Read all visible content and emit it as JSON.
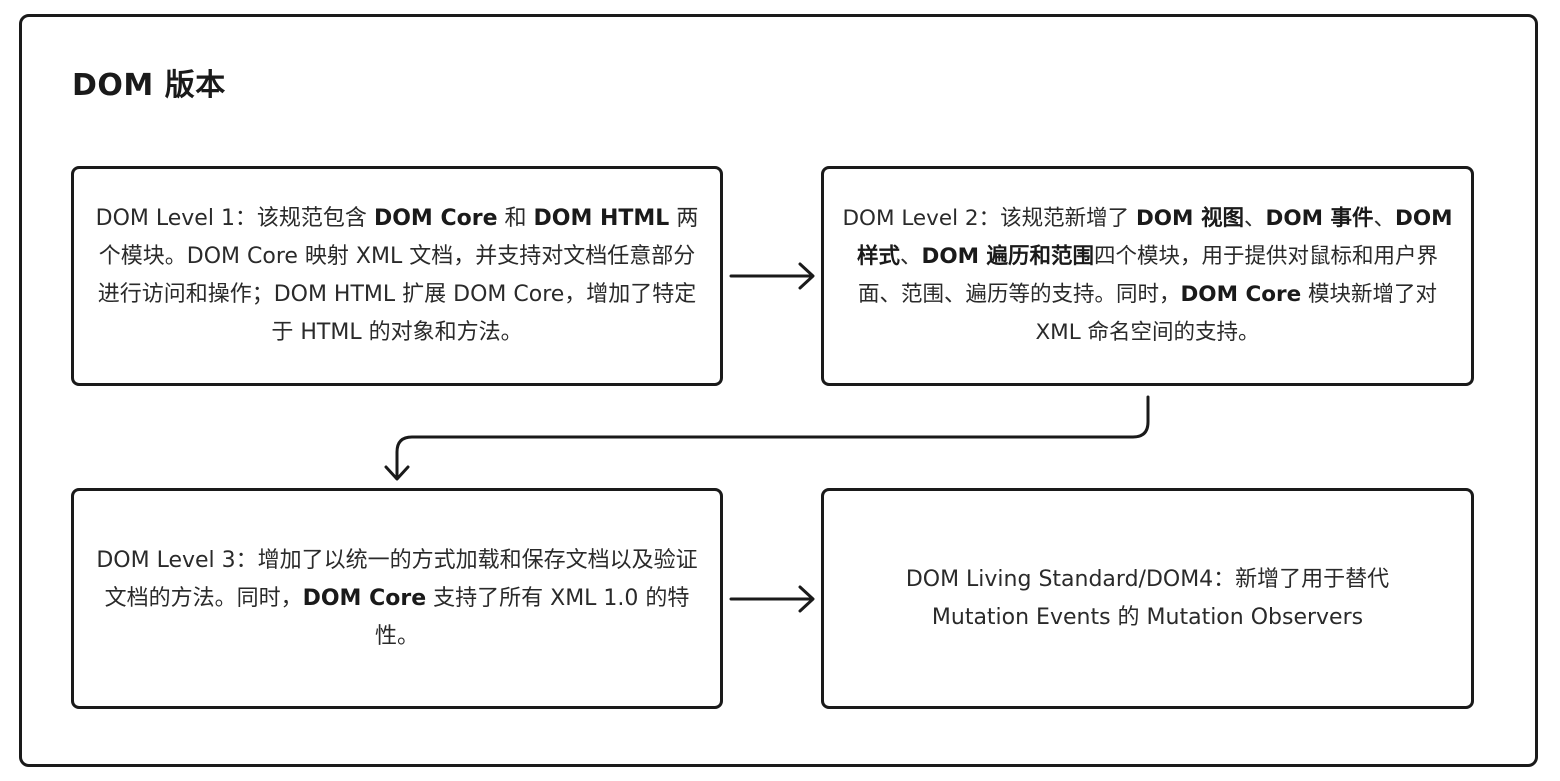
{
  "title": "DOM 版本",
  "boxes": {
    "level1": {
      "s1": "DOM Level 1：该规范包含 ",
      "b1": "DOM Core",
      "s2": " 和 ",
      "b2": "DOM HTML",
      "s3": " 两个模块。DOM Core 映射 XML 文档，并支持对文档任意部分进行访问和操作；DOM HTML 扩展 DOM Core，增加了特定于 HTML 的对象和方法。"
    },
    "level2": {
      "s1": "DOM Level 2：该规范新增了 ",
      "b1": "DOM 视图",
      "s2": "、",
      "b2": "DOM 事件",
      "s3": "、",
      "b3": "DOM 样式",
      "s4": "、",
      "b4": "DOM 遍历和范围",
      "s5": "四个模块，用于提供对鼠标和用户界面、范围、遍历等的支持。同时，",
      "b5": "DOM Core",
      "s6": " 模块新增了对 XML 命名空间的支持。"
    },
    "level3": {
      "s1": "DOM Level 3：增加了以统一的方式加载和保存文档以及验证文档的方法。同时，",
      "b1": "DOM Core",
      "s2": " 支持了所有 XML 1.0 的特性。"
    },
    "living": {
      "s1": "DOM Living Standard/DOM4：新增了用于替代 Mutation Events 的 Mutation Observers"
    }
  }
}
